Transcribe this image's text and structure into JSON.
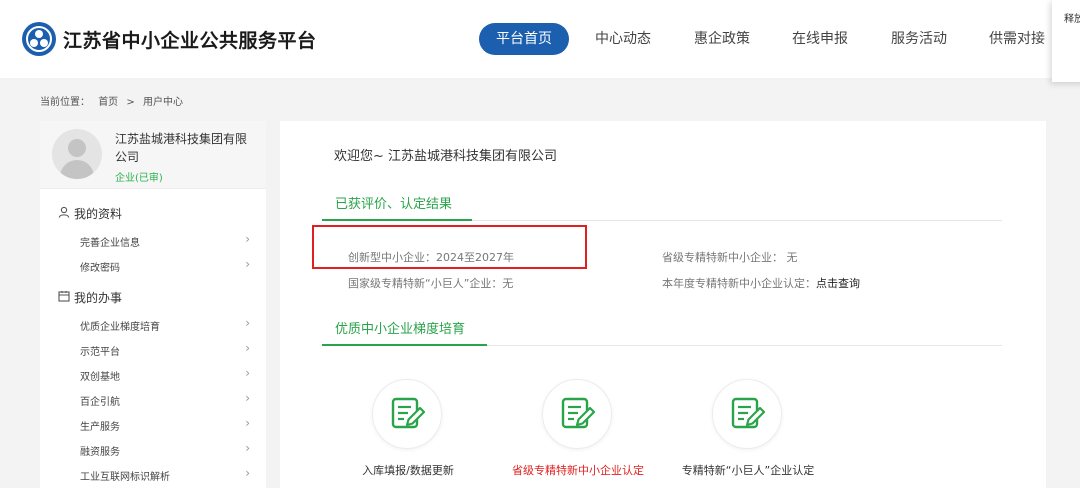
{
  "header": {
    "site_title": "江苏省中小企业公共服务平台",
    "nav": [
      "平台首页",
      "中心动态",
      "惠企政策",
      "在线申报",
      "服务活动",
      "供需对接"
    ],
    "popup_text": "释放"
  },
  "breadcrumb": {
    "label": "当前位置：",
    "home": "首页",
    "sep": ">",
    "current": "用户中心"
  },
  "sidebar": {
    "company_name": "江苏盐城港科技集团有限公司",
    "company_status": "企业(已审)",
    "sections": [
      {
        "icon": "user-icon",
        "title": "我的资料",
        "items": [
          "完善企业信息",
          "修改密码"
        ]
      },
      {
        "icon": "calendar-icon",
        "title": "我的办事",
        "items": [
          "优质企业梯度培育",
          "示范平台",
          "双创基地",
          "百企引航",
          "生产服务",
          "融资服务",
          "工业互联网标识解析"
        ]
      }
    ]
  },
  "main": {
    "welcome": "欢迎您~ 江苏盐城港科技集团有限公司",
    "section1_title": "已获评价、认定结果",
    "results": {
      "innovative": "创新型中小企业：2024至2027年",
      "provincial": "省级专精特新中小企业： 无",
      "giant": "国家级专精特新“小巨人”企业：无",
      "annual_label": "本年度专精特新中小企业认定：",
      "annual_link": "点击查询"
    },
    "section2_title": "优质中小企业梯度培育",
    "cards": [
      {
        "label": "入库填报/数据更新",
        "color": "#333333"
      },
      {
        "label": "省级专精特新中小企业认定",
        "color": "#e02020"
      },
      {
        "label": "专精特新“小巨人”企业认定",
        "color": "#333333"
      }
    ]
  },
  "colors": {
    "brand_blue": "#1b5fae",
    "green": "#2aa44a",
    "highlight_red": "#e02020"
  }
}
